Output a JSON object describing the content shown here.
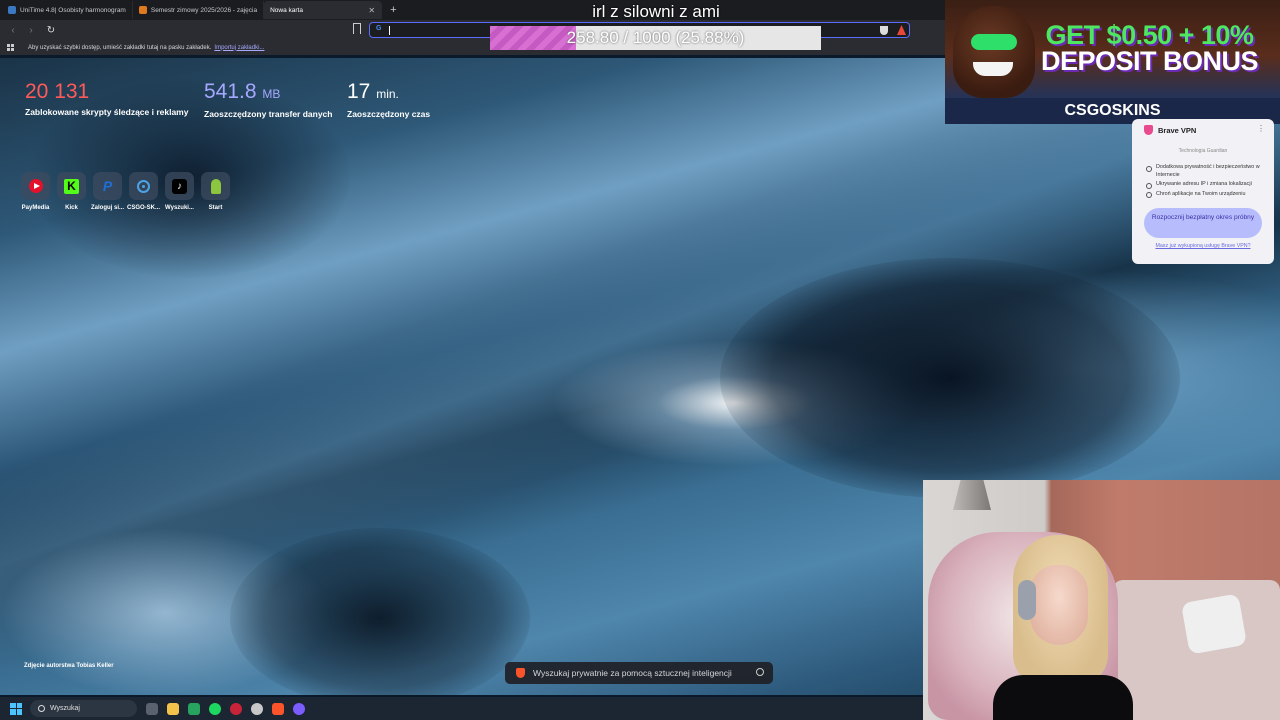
{
  "browser": {
    "tabs": [
      {
        "label": "UniTime 4.8| Osobisty harmonogram",
        "color": "#3a78c2"
      },
      {
        "label": "Semestr zimowy 2025/2026 - zajęcia",
        "color": "#e07a1e"
      },
      {
        "label": "Nowa karta",
        "active": true
      }
    ],
    "bookmark_bar_text": "Aby uzyskać szybki dostęp, umieść zakładki tutaj na pasku zakładek.",
    "bookmark_bar_link": "Importuj zakładki..."
  },
  "overlay": {
    "stream_title": "irl z silowni z ami",
    "progress_text": "258.80 / 1000 (25.88%)",
    "progress_value": 258.8,
    "progress_max": 1000
  },
  "stats": [
    {
      "value": "20 131",
      "unit": "",
      "label": "Zablokowane skrypty śledzące i reklamy",
      "color": "#ff5a5a"
    },
    {
      "value": "541.8",
      "unit": "MB",
      "label": "Zaoszczędzony transfer danych",
      "color": "#a6a8ff"
    },
    {
      "value": "17",
      "unit": "min.",
      "label": "Zaoszczędzony czas",
      "color": "#ffffff"
    }
  ],
  "shortcuts": [
    {
      "label": "PayMedia",
      "icon": "paymedia-icon"
    },
    {
      "label": "Kick",
      "icon": "kick-icon"
    },
    {
      "label": "Zaloguj si...",
      "icon": "paypal-icon"
    },
    {
      "label": "CSGO-SK...",
      "icon": "csgo-icon"
    },
    {
      "label": "Wyszuki...",
      "icon": "tiktok-icon"
    },
    {
      "label": "Start",
      "icon": "chess-icon"
    }
  ],
  "photo_credit": "Zdjęcie autorstwa Tobias Keller",
  "ai_search_placeholder": "Wyszukaj prywatnie za pomocą sztucznej inteligencji",
  "taskbar": {
    "search_label": "Wyszukaj"
  },
  "ad": {
    "line1": "GET $0.50 + 10%",
    "line2": "DEPOSIT BONUS",
    "brand": "CSGOSKINS"
  },
  "vpn": {
    "title": "Brave VPN",
    "tech": "Technologia Guardian",
    "features": [
      "Dodatkowa prywatność i bezpieczeństwo w Internecie",
      "Ukrywanie adresu IP i zmiana lokalizacji",
      "Chroń aplikacje na Twoim urządzeniu"
    ],
    "cta": "Rozpocznij bezpłatny okres próbny",
    "footer_link": "Masz już wykupioną usługę Brave VPN?"
  }
}
